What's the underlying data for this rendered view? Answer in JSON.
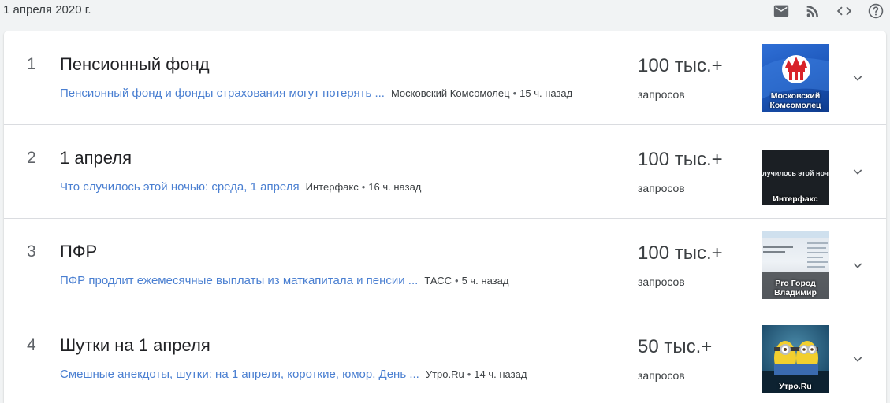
{
  "header": {
    "date": "1 апреля 2020 г.",
    "icons": [
      "mail-icon",
      "rss-icon",
      "embed-code-icon",
      "help-icon"
    ]
  },
  "colors": {
    "page_bg": "#f1f3f4",
    "card_bg": "#ffffff",
    "link": "#4a7fd1",
    "text": "#202124",
    "secondary": "#5f6368"
  },
  "trends": [
    {
      "rank": "1",
      "title": "Пенсионный фонд",
      "article": "Пенсионный фонд и фонды страхования могут потерять ...",
      "source": "Московский Комсомолец",
      "age": "15 ч. назад",
      "count": "100 тыс.+",
      "count_label": "запросов",
      "thumb_caption": "Московский Комсомолец"
    },
    {
      "rank": "2",
      "title": "1 апреля",
      "article": "Что случилось этой ночью: среда, 1 апреля",
      "source": "Интерфакс",
      "age": "16 ч. назад",
      "count": "100 тыс.+",
      "count_label": "запросов",
      "thumb_caption": "Интерфакс"
    },
    {
      "rank": "3",
      "title": "ПФР",
      "article": "ПФР продлит ежемесячные выплаты из маткапитала и пенсии ...",
      "source": "ТАСС",
      "age": "5 ч. назад",
      "count": "100 тыс.+",
      "count_label": "запросов",
      "thumb_caption": "Pro Город Владимир"
    },
    {
      "rank": "4",
      "title": "Шутки на 1 апреля",
      "article": "Смешные анекдоты, шутки: на 1 апреля, короткие, юмор, День ...",
      "source": "Утро.Ru",
      "age": "14 ч. назад",
      "count": "50 тыс.+",
      "count_label": "запросов",
      "thumb_caption": "Утро.Ru"
    }
  ],
  "thumb_text": {
    "t2_line": "случилось этой ночью:"
  }
}
